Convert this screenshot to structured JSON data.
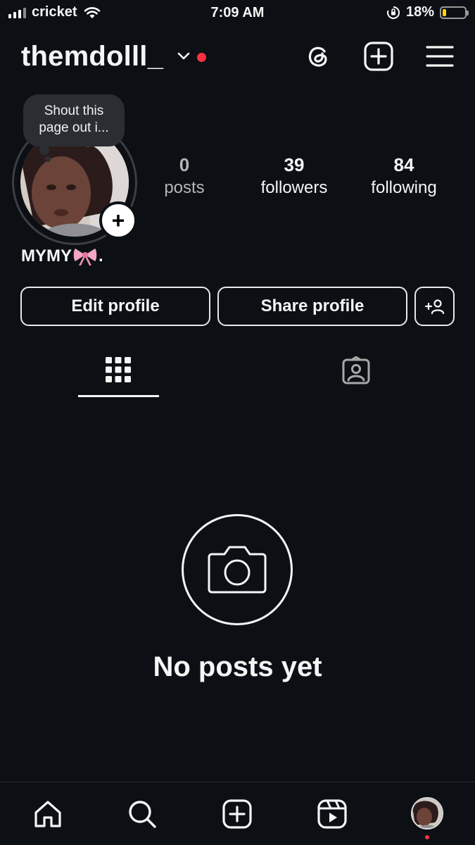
{
  "status_bar": {
    "carrier": "cricket",
    "time": "7:09 AM",
    "battery_percent": "18%",
    "battery_level": 0.18,
    "icons": [
      "signal-icon",
      "wifi-icon",
      "orientation-lock-icon",
      "battery-icon"
    ]
  },
  "header": {
    "username": "themdolll_",
    "icons": [
      "chevron-down-icon",
      "threads-icon",
      "create-icon",
      "menu-icon"
    ]
  },
  "profile": {
    "note": "Shout this page out i...",
    "display_name": "MYMY",
    "display_name_suffix": ".",
    "bio_emoji": "bow-emoji",
    "stats": [
      {
        "value": "0",
        "label": "posts"
      },
      {
        "value": "39",
        "label": "followers"
      },
      {
        "value": "84",
        "label": "following"
      }
    ]
  },
  "actions": {
    "edit_label": "Edit profile",
    "share_label": "Share profile",
    "discover_icon": "add-person-icon"
  },
  "tabs": [
    {
      "icon": "grid-icon",
      "active": true
    },
    {
      "icon": "tagged-icon",
      "active": false
    }
  ],
  "empty_state": {
    "icon": "camera-icon",
    "title": "No posts yet"
  },
  "bottom_nav": [
    "home-icon",
    "search-icon",
    "create-icon",
    "reels-icon",
    "profile-avatar"
  ],
  "colors": {
    "background": "#0c1014",
    "text": "#f5f5f5",
    "notification": "#ff3040",
    "battery": "#ffd60a"
  }
}
